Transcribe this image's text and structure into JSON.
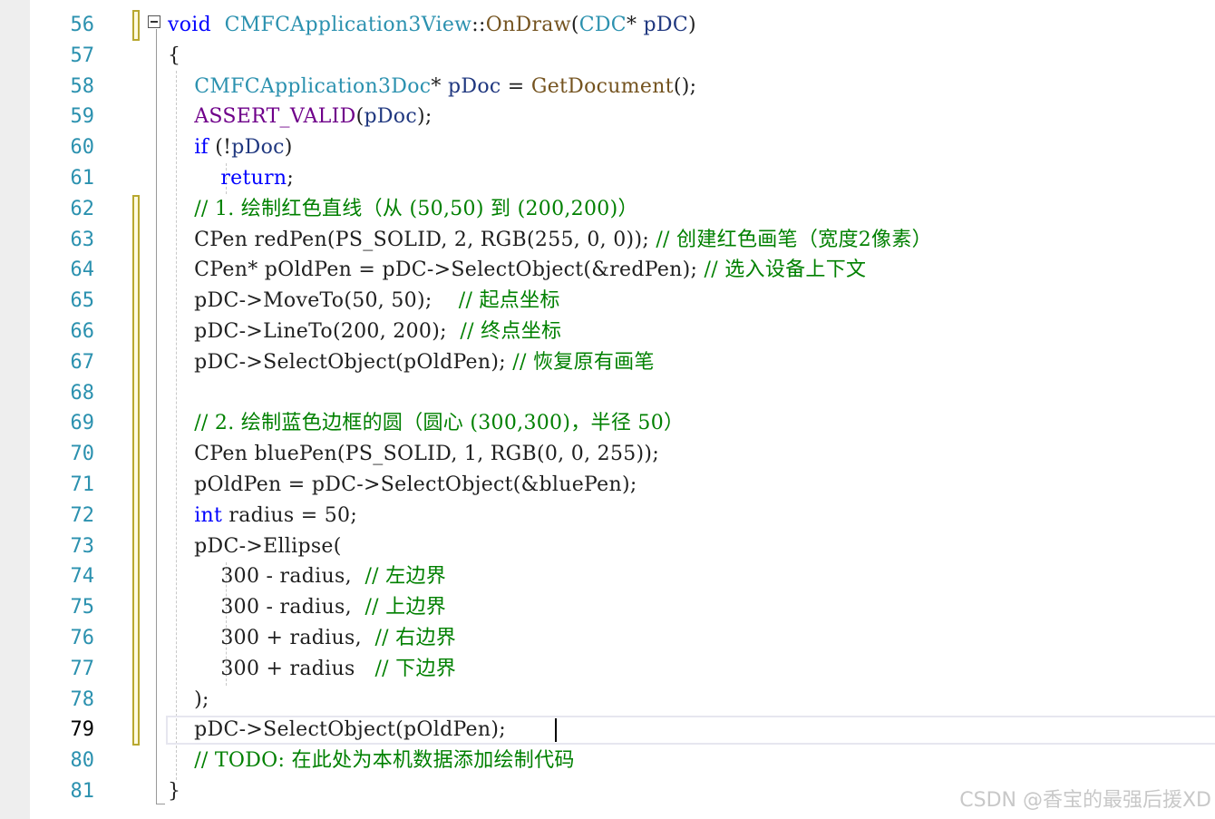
{
  "editor": {
    "colors": {
      "keyword": "#0000ff",
      "type": "#2b91af",
      "macro": "#6f008a",
      "function": "#74531f",
      "param": "#1f377f",
      "comment": "#008000",
      "text": "#1f1f1f",
      "line_number": "#2b91af"
    },
    "current_line": "79",
    "lines": [
      {
        "n": "56",
        "t": [
          [
            "kw",
            "void"
          ],
          [
            "",
            "  "
          ],
          [
            "ty",
            "CMFCApplication3View"
          ],
          [
            "",
            "::"
          ],
          [
            "fn",
            "OnDraw"
          ],
          [
            "",
            "("
          ],
          [
            "ty",
            "CDC"
          ],
          [
            "",
            "* "
          ],
          [
            "pm",
            "pDC"
          ],
          [
            "",
            ")"
          ]
        ]
      },
      {
        "n": "57",
        "t": [
          [
            "",
            "{"
          ]
        ]
      },
      {
        "n": "58",
        "t": [
          [
            "",
            "    "
          ],
          [
            "ty",
            "CMFCApplication3Doc"
          ],
          [
            "",
            "* "
          ],
          [
            "pm",
            "pDoc"
          ],
          [
            "",
            " = "
          ],
          [
            "fn",
            "GetDocument"
          ],
          [
            "",
            "();"
          ]
        ]
      },
      {
        "n": "59",
        "t": [
          [
            "",
            "    "
          ],
          [
            "mc",
            "ASSERT_VALID"
          ],
          [
            "",
            "("
          ],
          [
            "pm",
            "pDoc"
          ],
          [
            "",
            ");"
          ]
        ]
      },
      {
        "n": "60",
        "t": [
          [
            "",
            "    "
          ],
          [
            "kw",
            "if"
          ],
          [
            "",
            " (!"
          ],
          [
            "pm",
            "pDoc"
          ],
          [
            "",
            ")"
          ]
        ]
      },
      {
        "n": "61",
        "t": [
          [
            "",
            "        "
          ],
          [
            "kw",
            "return"
          ],
          [
            "",
            ";"
          ]
        ]
      },
      {
        "n": "62",
        "t": [
          [
            "",
            "    "
          ],
          [
            "cm",
            "// 1. 绘制红色直线（从 (50,50) 到 (200,200)）"
          ]
        ]
      },
      {
        "n": "63",
        "t": [
          [
            "",
            "    CPen redPen(PS_SOLID, 2, RGB(255, 0, 0)); "
          ],
          [
            "cm",
            "// 创建红色画笔（宽度2像素）"
          ]
        ]
      },
      {
        "n": "64",
        "t": [
          [
            "",
            "    CPen* pOldPen = pDC->SelectObject(&redPen); "
          ],
          [
            "cm",
            "// 选入设备上下文"
          ]
        ]
      },
      {
        "n": "65",
        "t": [
          [
            "",
            "    pDC->MoveTo(50, 50);    "
          ],
          [
            "cm",
            "// 起点坐标"
          ]
        ]
      },
      {
        "n": "66",
        "t": [
          [
            "",
            "    pDC->LineTo(200, 200);  "
          ],
          [
            "cm",
            "// 终点坐标"
          ]
        ]
      },
      {
        "n": "67",
        "t": [
          [
            "",
            "    pDC->SelectObject(pOldPen); "
          ],
          [
            "cm",
            "// 恢复原有画笔"
          ]
        ]
      },
      {
        "n": "68",
        "t": []
      },
      {
        "n": "69",
        "t": [
          [
            "",
            "    "
          ],
          [
            "cm",
            "// 2. 绘制蓝色边框的圆（圆心 (300,300)，半径 50）"
          ]
        ]
      },
      {
        "n": "70",
        "t": [
          [
            "",
            "    CPen bluePen(PS_SOLID, 1, RGB(0, 0, 255));"
          ]
        ]
      },
      {
        "n": "71",
        "t": [
          [
            "",
            "    pOldPen = pDC->SelectObject(&bluePen);"
          ]
        ]
      },
      {
        "n": "72",
        "t": [
          [
            "",
            "    "
          ],
          [
            "kw",
            "int"
          ],
          [
            "",
            " radius = 50;"
          ]
        ]
      },
      {
        "n": "73",
        "t": [
          [
            "",
            "    pDC->Ellipse("
          ]
        ]
      },
      {
        "n": "74",
        "t": [
          [
            "",
            "        300 - radius,  "
          ],
          [
            "cm",
            "// 左边界"
          ]
        ]
      },
      {
        "n": "75",
        "t": [
          [
            "",
            "        300 - radius,  "
          ],
          [
            "cm",
            "// 上边界"
          ]
        ]
      },
      {
        "n": "76",
        "t": [
          [
            "",
            "        300 + radius,  "
          ],
          [
            "cm",
            "// 右边界"
          ]
        ]
      },
      {
        "n": "77",
        "t": [
          [
            "",
            "        300 + radius   "
          ],
          [
            "cm",
            "// 下边界"
          ]
        ]
      },
      {
        "n": "78",
        "t": [
          [
            "",
            "    );"
          ]
        ]
      },
      {
        "n": "79",
        "t": [
          [
            "",
            "    pDC->SelectObject(pOldPen);"
          ]
        ]
      },
      {
        "n": "80",
        "t": [
          [
            "",
            "    "
          ],
          [
            "cm",
            "// TODO: 在此处为本机数据添加绘制代码"
          ]
        ]
      },
      {
        "n": "81",
        "t": [
          [
            "",
            "}"
          ]
        ]
      }
    ]
  },
  "watermark": "CSDN @香宝的最强后援XD"
}
